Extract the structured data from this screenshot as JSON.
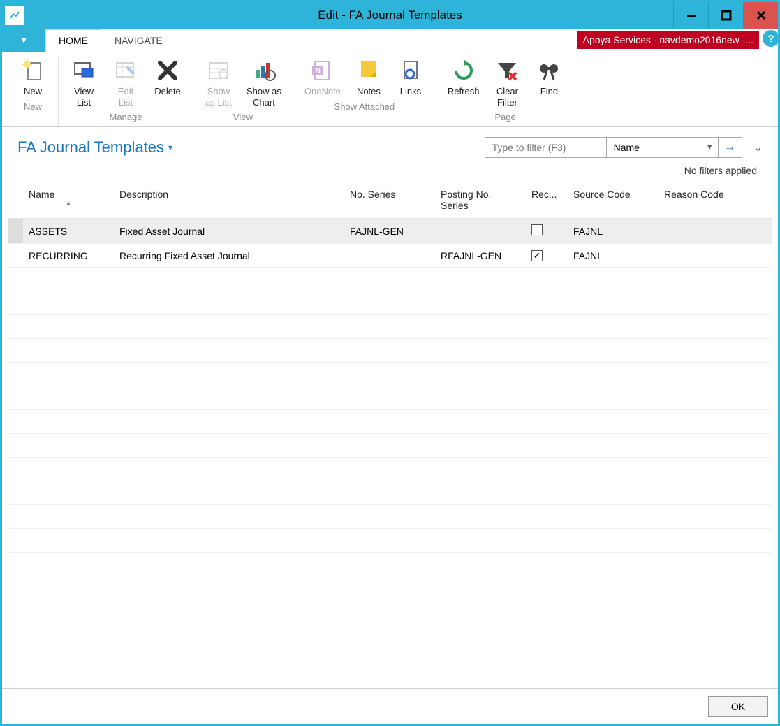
{
  "window": {
    "title": "Edit - FA Journal Templates"
  },
  "tabs": {
    "home": "HOME",
    "navigate": "NAVIGATE"
  },
  "brand": "Apoya Services - navdemo2016new -...",
  "ribbon": {
    "groups": {
      "new": {
        "label": "New",
        "items": {
          "new": "New"
        }
      },
      "manage": {
        "label": "Manage",
        "items": {
          "view_list": "View\nList",
          "edit_list": "Edit\nList",
          "delete": "Delete"
        }
      },
      "view": {
        "label": "View",
        "items": {
          "show_as_list": "Show\nas List",
          "show_as_chart": "Show as\nChart"
        }
      },
      "show_attached": {
        "label": "Show Attached",
        "items": {
          "onenote": "OneNote",
          "notes": "Notes",
          "links": "Links"
        }
      },
      "page": {
        "label": "Page",
        "items": {
          "refresh": "Refresh",
          "clear_filter": "Clear\nFilter",
          "find": "Find"
        }
      }
    }
  },
  "page_title": "FA Journal Templates",
  "filter": {
    "placeholder": "Type to filter (F3)",
    "field": "Name",
    "no_filters": "No filters applied"
  },
  "columns": {
    "name": "Name",
    "description": "Description",
    "no_series": "No. Series",
    "posting_no_series": "Posting No. Series",
    "recurring": "Rec...",
    "source_code": "Source Code",
    "reason_code": "Reason Code"
  },
  "rows": [
    {
      "name": "ASSETS",
      "description": "Fixed Asset Journal",
      "no_series": "FAJNL-GEN",
      "posting_no_series": "",
      "recurring": false,
      "source_code": "FAJNL",
      "reason_code": ""
    },
    {
      "name": "RECURRING",
      "description": "Recurring Fixed Asset Journal",
      "no_series": "",
      "posting_no_series": "RFAJNL-GEN",
      "recurring": true,
      "source_code": "FAJNL",
      "reason_code": ""
    }
  ],
  "footer": {
    "ok": "OK"
  }
}
